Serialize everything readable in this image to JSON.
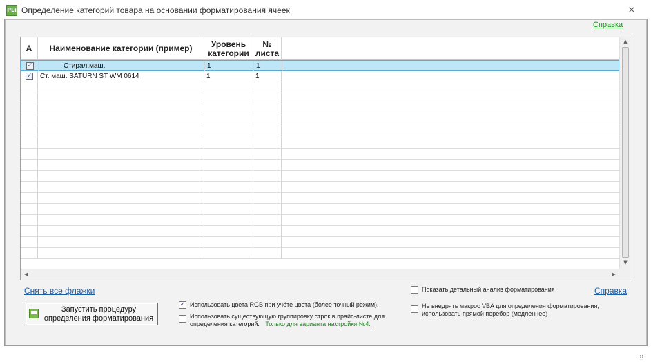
{
  "window": {
    "icon_text": "PLi",
    "title": "Определение категорий товара на основании форматирования ячеек",
    "close_glyph": "⨯"
  },
  "top_help_link": "Справка",
  "grid": {
    "columns": [
      {
        "label": "A"
      },
      {
        "label": "Наименование категории (пример)"
      },
      {
        "label": "Уровень\nкатегории"
      },
      {
        "label": "№\nлиста"
      }
    ],
    "rows": [
      {
        "checked": true,
        "name": "Стирал.маш.",
        "indent": true,
        "level": "1",
        "sheet": "1",
        "selected": true
      },
      {
        "checked": true,
        "name": "Ст. маш. SATURN ST WM 0614",
        "indent": false,
        "level": "1",
        "sheet": "1",
        "selected": false
      }
    ],
    "empty_rows": 16
  },
  "clear_flags_link": "Снять все флажки",
  "run_button": "Запустить процедуру\nопределения форматирования",
  "options": {
    "use_rgb": {
      "label": "Использовать цвета RGB при учёте цвета (более точный режим).",
      "checked": true
    },
    "use_grouping": {
      "label_line1": "Использовать существующую группировку строк в прайс-листе для",
      "label_line2": "определения категорий.",
      "link": "Только для варианта настройки №4.",
      "checked": false
    },
    "show_analysis": {
      "label": "Показать детальный анализ форматирования",
      "checked": false
    },
    "no_vba": {
      "label_line1": "Не внедрять макрос VBA для определения форматирования,",
      "label_line2": "использовать прямой перебор (медленнее)",
      "checked": false
    }
  },
  "bottom_help_link": "Справка",
  "check_glyph": "✓",
  "colors": {
    "accent_green": "#1a8a1a",
    "link_blue": "#1a5fa8",
    "selection": "#bfe6f7"
  }
}
